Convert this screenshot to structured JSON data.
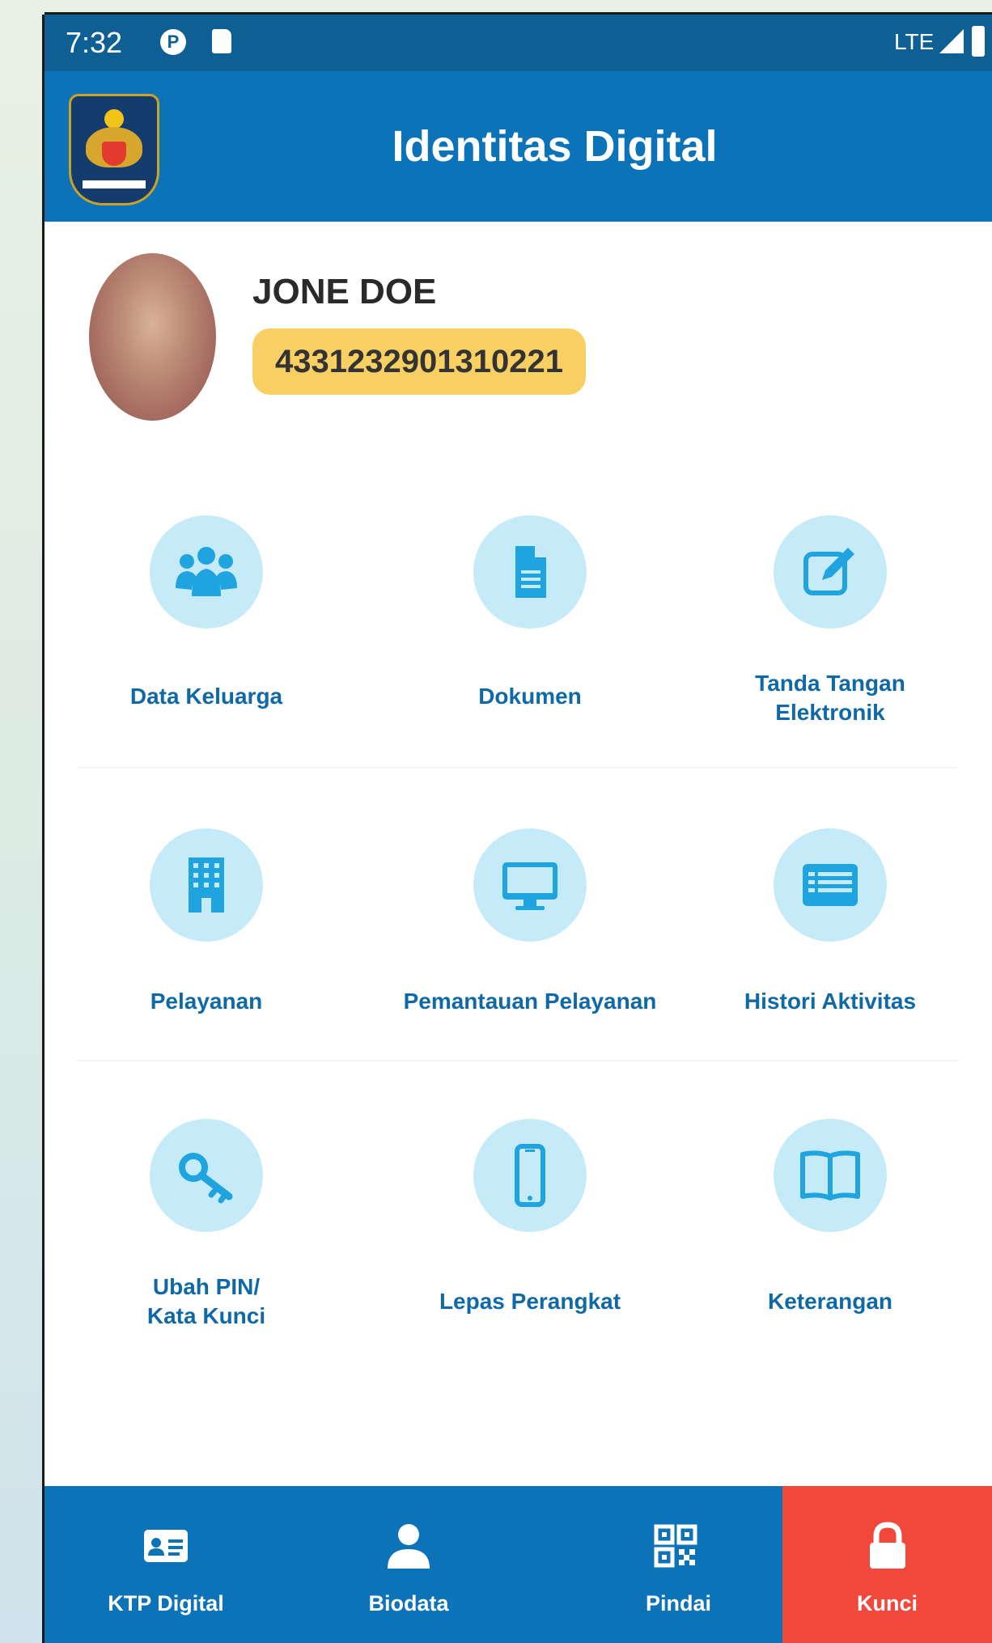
{
  "status_bar": {
    "time": "7:32",
    "network": "LTE",
    "icons": [
      "notification-p-icon",
      "sd-card-icon",
      "signal-icon",
      "battery-icon"
    ]
  },
  "header": {
    "title": "Identitas Digital",
    "logo": "kemendagri-emblem-icon"
  },
  "profile": {
    "name": "JONE DOE",
    "nik": "4331232901310221"
  },
  "menu": [
    {
      "label": "Data Keluarga",
      "label2": "",
      "icon": "family-group-icon"
    },
    {
      "label": "Dokumen",
      "label2": "",
      "icon": "document-icon"
    },
    {
      "label": "Tanda Tangan",
      "label2": "Elektronik",
      "icon": "edit-signature-icon"
    },
    {
      "label": "Pelayanan",
      "label2": "",
      "icon": "building-icon"
    },
    {
      "label": "Pemantauan Pelayanan",
      "label2": "",
      "icon": "monitor-icon"
    },
    {
      "label": "Histori Aktivitas",
      "label2": "",
      "icon": "list-history-icon"
    },
    {
      "label": "Ubah PIN/",
      "label2": "Kata Kunci",
      "icon": "key-icon"
    },
    {
      "label": "Lepas Perangkat",
      "label2": "",
      "icon": "smartphone-icon"
    },
    {
      "label": "Keterangan",
      "label2": "",
      "icon": "book-icon"
    }
  ],
  "bottom_nav": [
    {
      "label": "KTP Digital",
      "icon": "id-card-icon",
      "active": false
    },
    {
      "label": "Biodata",
      "icon": "person-icon",
      "active": false
    },
    {
      "label": "Pindai",
      "icon": "qr-code-icon",
      "active": false
    },
    {
      "label": "Kunci",
      "icon": "lock-icon",
      "active": true
    }
  ],
  "colors": {
    "header": "#0d73b8",
    "status_bar": "#0e5f94",
    "menu_label": "#0f69a6",
    "icon_circle": "#c6ebf8",
    "icon_fill": "#1fa4e0",
    "nik_badge": "#f7cf62",
    "active_tab": "#f2473b"
  }
}
